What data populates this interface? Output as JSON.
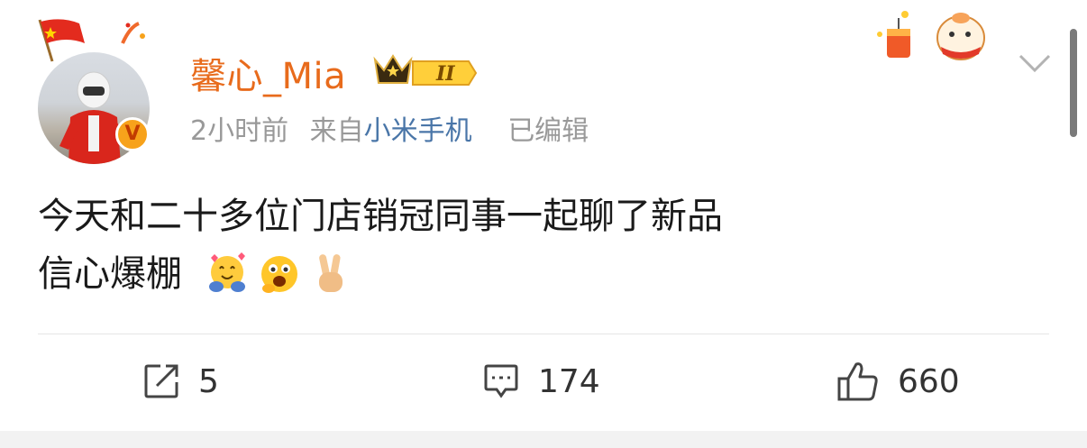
{
  "post": {
    "user": {
      "name": "馨心_Mia",
      "level_badge": "II",
      "verified_icon": "v-icon"
    },
    "meta": {
      "time": "2小时前",
      "source_prefix": "来自",
      "device": "小米手机",
      "edited": "已编辑"
    },
    "content": {
      "line1": "今天和二十多位门店销冠同事一起聊了新品",
      "line2": "信心爆棚"
    },
    "actions": {
      "repost_count": "5",
      "comment_count": "174",
      "like_count": "660"
    }
  },
  "icons": {
    "flag": "china-flag-icon",
    "crown": "crown-badge-icon",
    "chevron": "chevron-down-icon",
    "repost": "share-icon",
    "comment": "comment-icon",
    "like": "thumbs-up-icon"
  },
  "colors": {
    "username": "#e86b1c",
    "device_link": "#4a76a8",
    "meta_gray": "#999999"
  }
}
